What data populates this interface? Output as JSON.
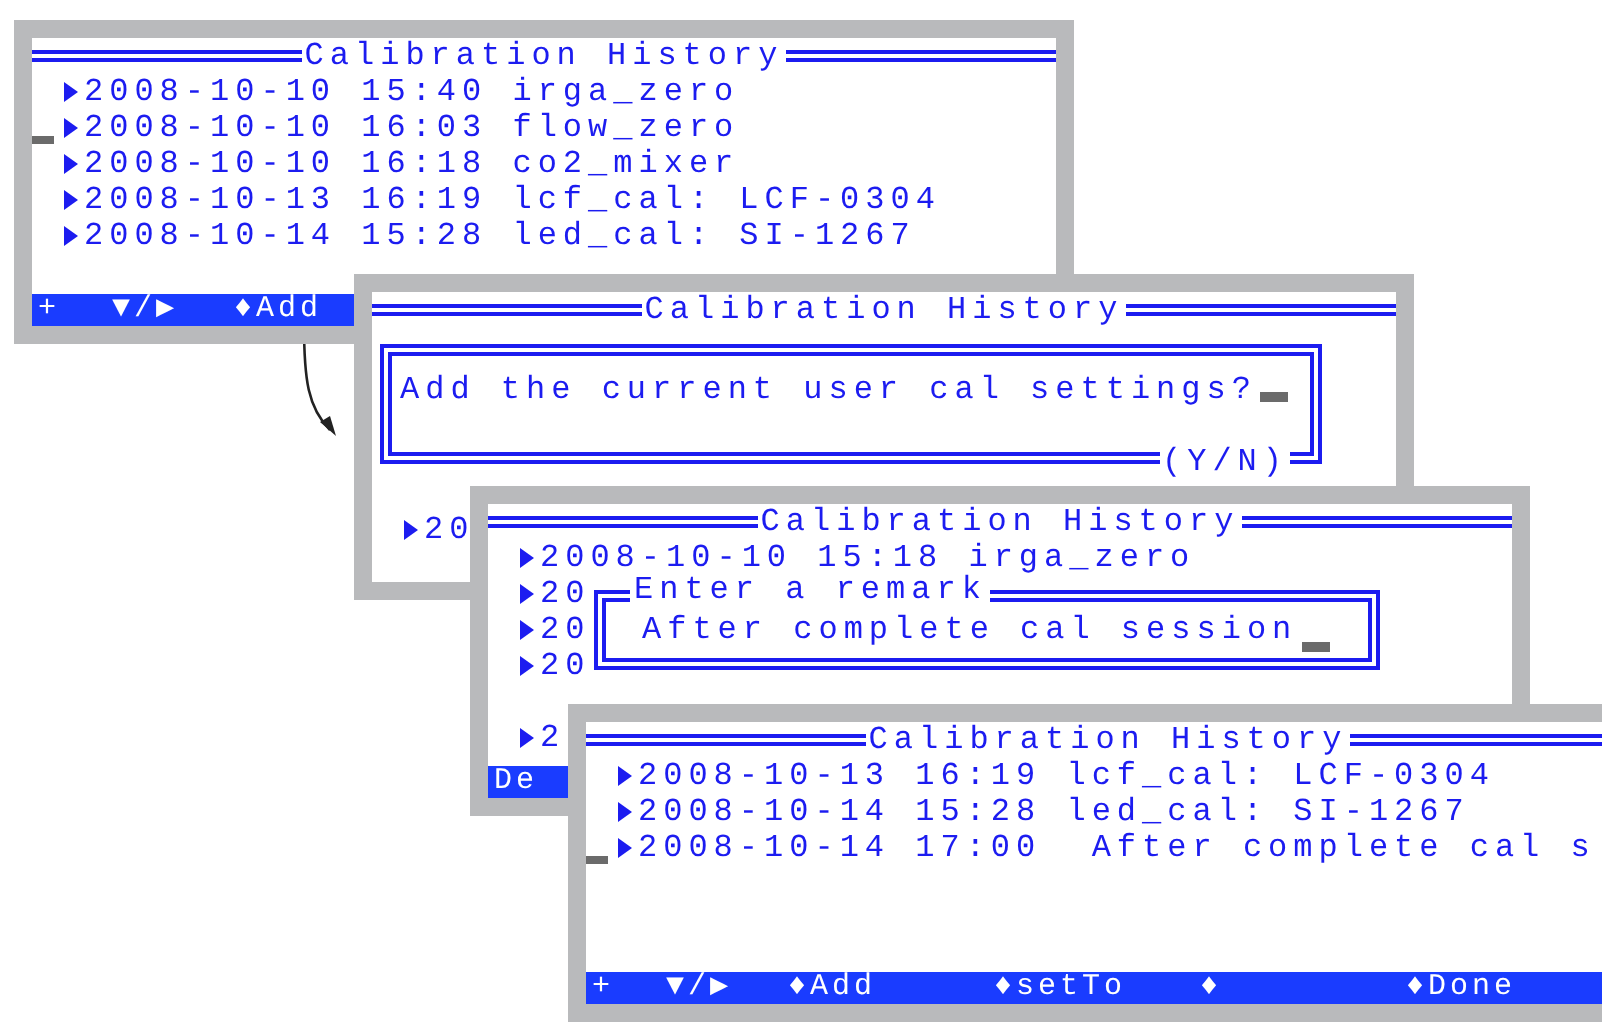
{
  "screens": [
    {
      "title": "Calibration History",
      "rows": [
        {
          "text": "2008-10-10 15:40 irga_zero",
          "cursor": false
        },
        {
          "text": "2008-10-10 16:03 flow_zero",
          "cursor": true
        },
        {
          "text": "2008-10-10 16:18 co2_mixer",
          "cursor": false
        },
        {
          "text": "2008-10-13 16:19 lcf_cal: LCF-0304",
          "cursor": false
        },
        {
          "text": "2008-10-14 15:28 led_cal: SI-1267",
          "cursor": false
        }
      ],
      "softkeys": [
        "+",
        "▼/▶",
        "♦Add"
      ]
    },
    {
      "title": "Calibration History",
      "dialog": {
        "kind": "confirm",
        "prompt": "Add the current user cal settings?",
        "hint": "(Y/N)"
      },
      "rows": [
        {
          "text": "20",
          "cursor": false
        }
      ]
    },
    {
      "title": "Calibration History",
      "rows": [
        {
          "text": "2008-10-10 15:18 irga_zero",
          "cursor": false
        },
        {
          "text": "20",
          "cursor": false
        },
        {
          "text": "20",
          "cursor": false
        },
        {
          "text": "20",
          "cursor": false
        },
        {
          "text": "2",
          "cursor": false
        }
      ],
      "dialog": {
        "kind": "remark",
        "label": "Enter a remark",
        "value": "After complete cal session"
      },
      "softkeys": [
        "De"
      ]
    },
    {
      "title": "Calibration History",
      "rows": [
        {
          "text": "2008-10-13 16:19 lcf_cal: LCF-0304",
          "cursor": false
        },
        {
          "text": "2008-10-14 15:28 led_cal: SI-1267",
          "cursor": false
        },
        {
          "text": "2008-10-14 17:00  After complete cal s",
          "cursor": true
        }
      ],
      "softkeys": [
        "+",
        "▼/▶",
        "♦Add",
        "♦setTo",
        "♦",
        "♦Done"
      ]
    }
  ]
}
